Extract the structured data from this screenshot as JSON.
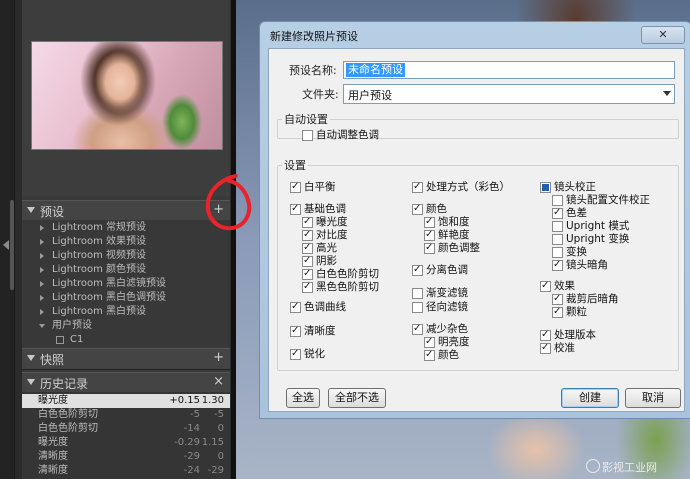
{
  "lr_panel": {
    "presets_header": {
      "title": "预设",
      "button": "+"
    },
    "preset_tree": [
      {
        "label": "Lightroom 常规预设"
      },
      {
        "label": "Lightroom 效果预设"
      },
      {
        "label": "Lightroom 视频预设"
      },
      {
        "label": "Lightroom 颜色预设"
      },
      {
        "label": "Lightroom 黑白滤镜预设"
      },
      {
        "label": "Lightroom 黑白色调预设"
      },
      {
        "label": "Lightroom 黑白预设"
      },
      {
        "label": "用户预设"
      }
    ],
    "preset_leaf": "C1",
    "snapshots_header": {
      "title": "快照",
      "button": "+"
    },
    "history_header": {
      "title": "历史记录",
      "button": "×"
    },
    "history": [
      {
        "name": "曝光度",
        "delta": "+0.15",
        "value": "1.30",
        "selected": true
      },
      {
        "name": "白色色阶剪切",
        "delta": "-5",
        "value": "-5"
      },
      {
        "name": "白色色阶剪切",
        "delta": "-14",
        "value": "0"
      },
      {
        "name": "曝光度",
        "delta": "-0.29",
        "value": "1.15"
      },
      {
        "name": "清晰度",
        "delta": "-29",
        "value": "0"
      },
      {
        "name": "清晰度",
        "delta": "-24",
        "value": "-29"
      }
    ]
  },
  "dialog": {
    "title": "新建修改照片预设",
    "close": "✕",
    "name_label": "预设名称:",
    "name_value": "未命名预设",
    "folder_label": "文件夹:",
    "folder_value": "用户预设",
    "auto_group": {
      "legend": "自动设置",
      "auto_tone": {
        "label": "自动调整色调",
        "checked": false
      }
    },
    "settings_group": {
      "legend": "设置",
      "col1": [
        {
          "label": "白平衡",
          "checked": true
        },
        {
          "label": "基础色调",
          "checked": true
        },
        {
          "label": "曝光度",
          "checked": true
        },
        {
          "label": "对比度",
          "checked": true
        },
        {
          "label": "高光",
          "checked": true
        },
        {
          "label": "阴影",
          "checked": true
        },
        {
          "label": "白色色阶剪切",
          "checked": true
        },
        {
          "label": "黑色色阶剪切",
          "checked": true
        },
        {
          "label": "色调曲线",
          "checked": true
        },
        {
          "label": "清晰度",
          "checked": true
        },
        {
          "label": "锐化",
          "checked": true
        }
      ],
      "col2": [
        {
          "label": "处理方式（彩色）",
          "checked": true
        },
        {
          "label": "颜色",
          "checked": true
        },
        {
          "label": "饱和度",
          "checked": true
        },
        {
          "label": "鲜艳度",
          "checked": true
        },
        {
          "label": "颜色调整",
          "checked": true
        },
        {
          "label": "分离色调",
          "checked": true
        },
        {
          "label": "渐变滤镜",
          "checked": false
        },
        {
          "label": "径向滤镜",
          "checked": false
        },
        {
          "label": "减少杂色",
          "checked": true
        },
        {
          "label": "明亮度",
          "checked": true
        },
        {
          "label": "颜色",
          "checked": true
        }
      ],
      "col3": [
        {
          "label": "镜头校正",
          "checked": "partial"
        },
        {
          "label": "镜头配置文件校正",
          "checked": false
        },
        {
          "label": "色差",
          "checked": true
        },
        {
          "label": "Upright 模式",
          "checked": false
        },
        {
          "label": "Upright 变换",
          "checked": false
        },
        {
          "label": "变换",
          "checked": false
        },
        {
          "label": "镜头暗角",
          "checked": true
        },
        {
          "label": "效果",
          "checked": true
        },
        {
          "label": "裁剪后暗角",
          "checked": true
        },
        {
          "label": "颗粒",
          "checked": true
        },
        {
          "label": "处理版本",
          "checked": true
        },
        {
          "label": "校准",
          "checked": true
        }
      ]
    },
    "buttons": {
      "select_all": "全选",
      "select_none": "全部不选",
      "create": "创建",
      "cancel": "取消"
    }
  },
  "watermark": "影视工业网",
  "colors": {
    "annotation_red": "#e8242a",
    "selection_blue": "#3399ff",
    "dialog_frame": "#b7cfe4"
  }
}
